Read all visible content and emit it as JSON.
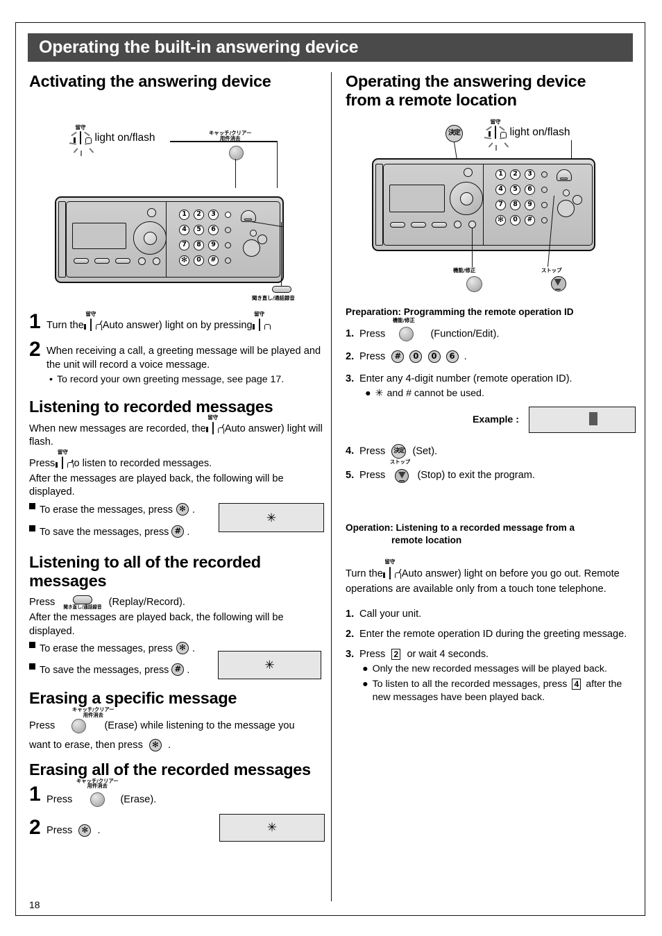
{
  "header": {
    "title": "Operating the built-in answering device"
  },
  "page_number": "18",
  "left": {
    "section1_title": "Activating the answering device",
    "diagram": {
      "light_label": "light on/flash",
      "auto_answer_kanji": "留守",
      "clear_btn_label_line1": "キャッチ/クリアー",
      "clear_btn_label_line2": "用件消去",
      "replay_btn_label": "聞き直し/通話録音",
      "keypad": [
        "1",
        "2",
        "3",
        "4",
        "5",
        "6",
        "7",
        "8",
        "9",
        "✻",
        "0",
        "#"
      ]
    },
    "step1_num": "1",
    "step1_a": "Turn the",
    "step1_b": "(Auto answer) light on by pressing",
    "step1_c": ".",
    "step2_num": "2",
    "step2_text": "When receiving a call, a greeting message will be played and the unit will record a voice message.",
    "step2_bullet": "To record your own greeting message, see page 17.",
    "section2_title": "Listening to recorded messages",
    "s2_p1_a": "When new messages are recorded, the",
    "s2_p1_b": "(Auto answer) light will flash.",
    "s2_p2_a": "Press",
    "s2_p2_b": "to listen to recorded messages.",
    "s2_p3": "After the messages are played back, the following will be displayed.",
    "s2_erase_a": "To erase the messages, press",
    "s2_erase_b": ".",
    "s2_save_a": "To save the messages, press",
    "s2_save_b": ".",
    "s2_lcd": "✳",
    "section3_title": "Listening to all of the recorded messages",
    "s3_press": "Press",
    "s3_replay_label": "聞き直し/通話録音",
    "s3_replay_paren": "(Replay/Record).",
    "s3_p2": "After the messages are played back, the following will be displayed.",
    "s3_erase_a": "To erase the messages, press",
    "s3_erase_b": ".",
    "s3_save_a": "To save the messages, press",
    "s3_save_b": ".",
    "s3_lcd": "✳",
    "section4_title": "Erasing a specific message",
    "s4_btn_l1": "キャッチ/クリアー",
    "s4_btn_l2": "用件消去",
    "s4_line1_a": "Press",
    "s4_line1_b": "(Erase) while listening to the message you",
    "s4_line2_a": "want to erase, then press",
    "s4_line2_b": ".",
    "section5_title": "Erasing all of the recorded messages",
    "s5_step1_num": "1",
    "s5_step1_a": "Press",
    "s5_step1_b": "(Erase).",
    "s5_btn_l1": "キャッチ/クリアー",
    "s5_btn_l2": "用件消去",
    "s5_step2_num": "2",
    "s5_step2_a": "Press",
    "s5_step2_b": ".",
    "s5_lcd": "✳"
  },
  "right": {
    "section_title_l1": "Operating the answering device",
    "section_title_l2": "from a remote location",
    "diagram": {
      "set_btn_kanji": "決定",
      "light_label": "light on/flash",
      "auto_answer_kanji": "留守",
      "function_btn_label": "機能/修正",
      "stop_btn_label": "ストップ",
      "keypad": [
        "1",
        "2",
        "3",
        "4",
        "5",
        "6",
        "7",
        "8",
        "9",
        "✻",
        "0",
        "#"
      ]
    },
    "prep_heading": "Preparation: Programming the remote operation ID",
    "prep_steps": [
      {
        "num": "1.",
        "a": "Press",
        "b": "(Function/Edit).",
        "btn_label": "機能/修正"
      },
      {
        "num": "2.",
        "a": "Press",
        "keys": [
          "#",
          "0",
          "0",
          "6"
        ],
        "b": "."
      },
      {
        "num": "3.",
        "a": "Enter any 4-digit number (remote operation ID).",
        "bullet": "and # cannot be used.",
        "bullet_star": "✳"
      },
      {
        "num": "4.",
        "a": "Press",
        "b": "(Set).",
        "key_kanji": "決定"
      },
      {
        "num": "5.",
        "a": "Press",
        "b": "(Stop) to exit the program.",
        "btn_label": "ストップ"
      }
    ],
    "example_label": "Example :",
    "op_heading_l1": "Operation: Listening to a recorded message from a",
    "op_heading_l2": "remote location",
    "op_intro_a": "Turn the",
    "op_intro_b": "(Auto answer) light on before you go out. Remote operations are available only from a touch tone telephone.",
    "op_steps": [
      {
        "num": "1.",
        "text": "Call your unit."
      },
      {
        "num": "2.",
        "text": "Enter the remote operation ID during the greeting message."
      },
      {
        "num": "3.",
        "a": "Press",
        "key": "2",
        "b": "or wait 4 seconds."
      }
    ],
    "op_bullet1": "Only the new recorded messages will be played back.",
    "op_bullet2_a": "To listen to all the recorded messages, press",
    "op_bullet2_key": "4",
    "op_bullet2_b": "after the new messages have been played back."
  },
  "colors": {
    "header_bg": "#4a4a4a",
    "lcd_bg": "#e6e6e6",
    "cursor": "#595959"
  }
}
